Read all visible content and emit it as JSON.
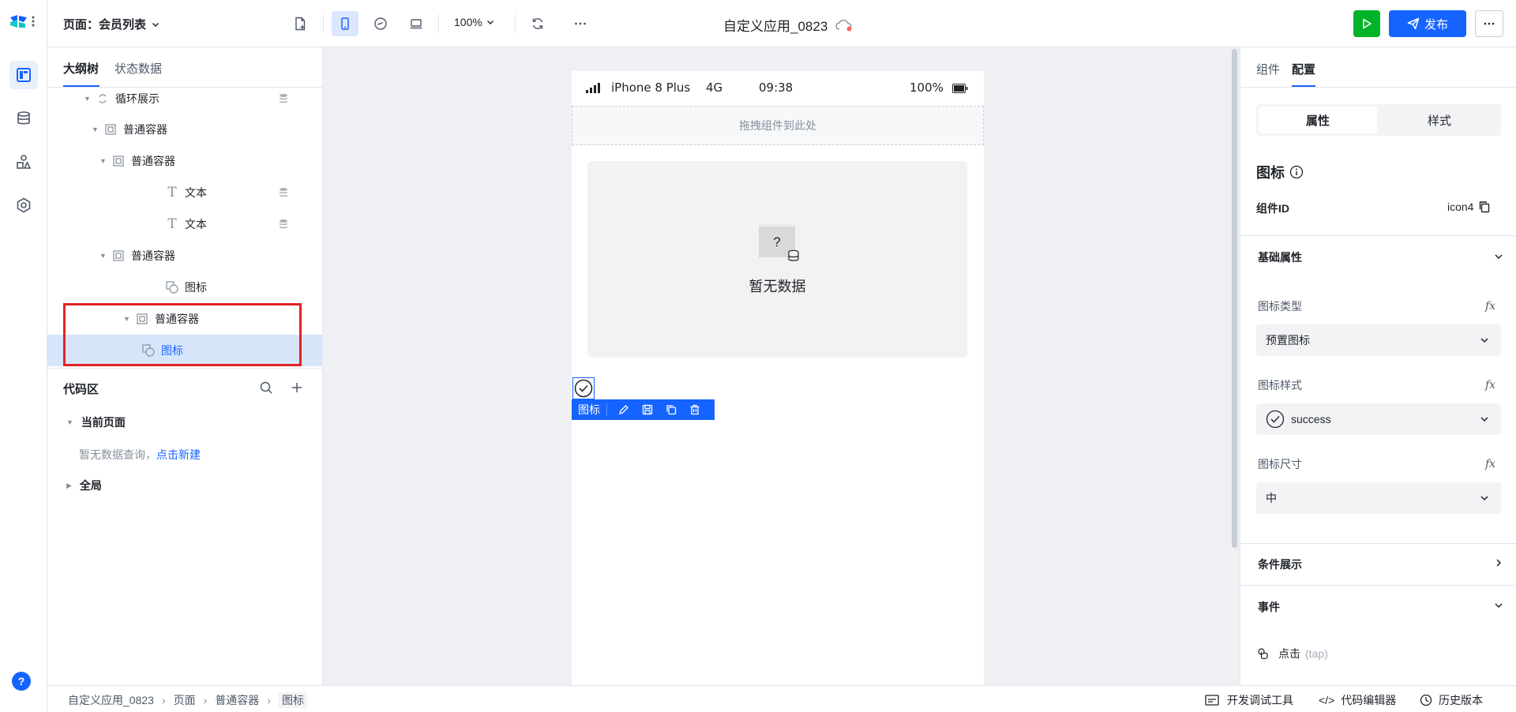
{
  "topbar": {
    "page_label": "页面：会员列表",
    "zoom": "100%",
    "app_title": "自定义应用_0823",
    "publish_label": "发布"
  },
  "left_panel": {
    "tabs": [
      {
        "label": "大纲树",
        "active": true
      },
      {
        "label": "状态数据",
        "active": false
      }
    ],
    "tree": [
      {
        "label": "循环展示",
        "depth": 0
      },
      {
        "label": "普通容器",
        "depth": 1
      },
      {
        "label": "普通容器",
        "depth": 2
      },
      {
        "label": "文本",
        "depth": 3
      },
      {
        "label": "文本",
        "depth": 3
      },
      {
        "label": "普通容器",
        "depth": 2
      },
      {
        "label": "图标",
        "depth": 3
      },
      {
        "label": "普通容器",
        "depth": 0
      },
      {
        "label": "图标",
        "depth": 1,
        "selected": true
      }
    ],
    "code_area": {
      "title": "代码区",
      "current_page": "当前页面",
      "empty_text": "暂无数据查询，",
      "create_link": "点击新建",
      "global": "全局"
    }
  },
  "canvas": {
    "status": {
      "device": "iPhone 8 Plus",
      "network": "4G",
      "time": "09:38",
      "battery": "100%"
    },
    "drop_hint": "拖拽组件到此处",
    "empty_text": "暂无数据",
    "placeholder_char": "?",
    "toolbar_label": "图标"
  },
  "right_panel": {
    "tabs": [
      {
        "label": "组件",
        "active": false
      },
      {
        "label": "配置",
        "active": true
      }
    ],
    "segments": [
      {
        "label": "属性",
        "active": true
      },
      {
        "label": "样式",
        "active": false
      }
    ],
    "title": "图标",
    "component_id_label": "组件ID",
    "component_id": "icon4",
    "basic_props": "基础属性",
    "icon_type_label": "图标类型",
    "icon_type_value": "预置图标",
    "icon_style_label": "图标样式",
    "icon_style_value": "success",
    "icon_size_label": "图标尺寸",
    "icon_size_value": "中",
    "condition_label": "条件展示",
    "events_label": "事件",
    "event_name": "点击",
    "event_code": "(tap)"
  },
  "statusbar": {
    "breadcrumb": [
      "自定义应用_0823",
      "页面",
      "普通容器",
      "图标"
    ],
    "dev_tools": "开发调试工具",
    "code_editor": "代码编辑器",
    "history": "历史版本"
  },
  "colors": {
    "accent": "#1664ff",
    "run": "#00b42a",
    "selection": "#d7e5fb",
    "highlight_box": "#e02424"
  }
}
